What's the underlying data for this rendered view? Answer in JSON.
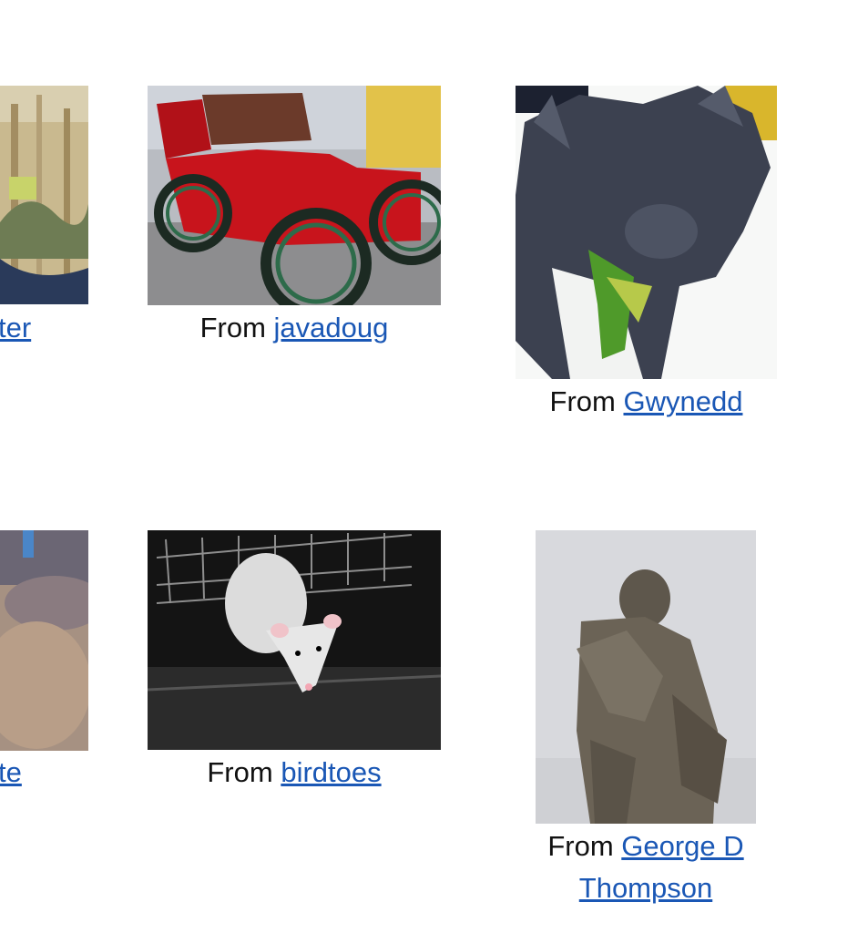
{
  "gallery": {
    "prefix": "From",
    "items": [
      {
        "name": "wall-art",
        "link_text": "ter",
        "link_text_2": ""
      },
      {
        "name": "red-car",
        "link_text": "javadoug",
        "link_text_2": ""
      },
      {
        "name": "cat",
        "link_text": "Gwynedd",
        "link_text_2": ""
      },
      {
        "name": "blurred",
        "link_text": "te",
        "link_text_2": ""
      },
      {
        "name": "rat",
        "link_text": "birdtoes",
        "link_text_2": ""
      },
      {
        "name": "statue",
        "link_text": "George D",
        "link_text_2": "Thompson"
      }
    ]
  }
}
